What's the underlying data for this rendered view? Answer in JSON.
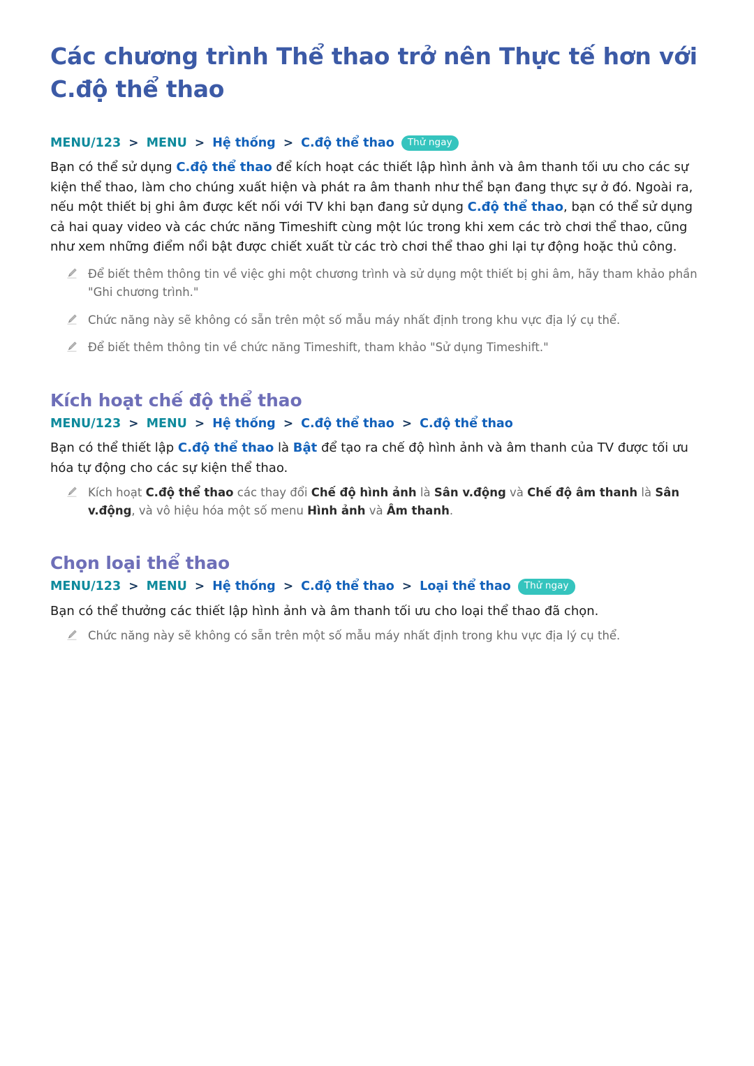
{
  "colors": {
    "title": "#3c5aa6",
    "section_heading": "#6e6fb8",
    "breadcrumb_menu": "#0e8a9c",
    "breadcrumb_item": "#1261ba",
    "breadcrumb_separator": "#16365c",
    "badge_background": "#35c4be",
    "badge_text": "#ffffff",
    "body_text": "#1c1c1c",
    "note_text": "#6b6b6b",
    "inline_emphasis": "#1261ba"
  },
  "document": {
    "title": "Các chương trình Thể thao trở nên Thực tế hơn với C.độ thể thao"
  },
  "intro": {
    "breadcrumb": {
      "menu123": "MENU/123",
      "menu": "MENU",
      "system": "Hệ thống",
      "sports_mode": "C.độ thể thao",
      "separator": ">",
      "badge": "Thử ngay"
    },
    "paragraph": {
      "part1": "Bạn có thể sử dụng ",
      "em1": "C.độ thể thao",
      "part2": " để kích hoạt các thiết lập hình ảnh và âm thanh tối ưu cho các sự kiện thể thao, làm cho chúng xuất hiện và phát ra âm thanh như thể bạn đang thực sự ở đó. Ngoài ra, nếu một thiết bị ghi âm được kết nối với TV khi bạn đang sử dụng ",
      "em2": "C.độ thể thao",
      "part3": ", bạn có thể sử dụng cả hai quay video và các chức năng Timeshift cùng một lúc trong khi xem các trò chơi thể thao, cũng như xem những điểm nổi bật được chiết xuất từ các trò chơi thể thao ghi lại tự động hoặc thủ công."
    },
    "notes": [
      "Để biết thêm thông tin về việc ghi một chương trình và sử dụng một thiết bị ghi âm, hãy tham khảo phần \"Ghi chương trình.\"",
      "Chức năng này sẽ không có sẵn trên một số mẫu máy nhất định trong khu vực địa lý cụ thể.",
      "Để biết thêm thông tin về chức năng Timeshift, tham khảo \"Sử dụng Timeshift.\""
    ]
  },
  "section_activate": {
    "heading": "Kích hoạt chế độ thể thao",
    "breadcrumb": {
      "menu123": "MENU/123",
      "menu": "MENU",
      "system": "Hệ thống",
      "sports_mode": "C.độ thể thao",
      "sports_mode_2": "C.độ thể thao",
      "separator": ">"
    },
    "paragraph": {
      "part1": "Bạn có thể thiết lập ",
      "em1": "C.độ thể thao",
      "part2": " là ",
      "em2": "Bật",
      "part3": " để tạo ra chế độ hình ảnh và âm thanh của TV được tối ưu hóa tự động cho các sự kiện thể thao."
    },
    "note": {
      "part1": "Kích hoạt ",
      "b1": "C.độ thể thao",
      "part2": " các thay đổi ",
      "b2": "Chế độ hình ảnh",
      "part3": " là ",
      "b3": "Sân v.động",
      "part4": " và ",
      "b4": "Chế độ âm thanh",
      "part5": " là ",
      "b5": "Sân v.động",
      "part6": ", và vô hiệu hóa một số menu ",
      "b6": "Hình ảnh",
      "part7": " và ",
      "b7": "Âm thanh",
      "part8": "."
    }
  },
  "section_choose": {
    "heading": "Chọn loại thể thao",
    "breadcrumb": {
      "menu123": "MENU/123",
      "menu": "MENU",
      "system": "Hệ thống",
      "sports_mode": "C.độ thể thao",
      "sport_type": "Loại thể thao",
      "separator": ">",
      "badge": "Thử ngay"
    },
    "paragraph": "Bạn có thể thưởng các thiết lập hình ảnh và âm thanh tối ưu cho loại thể thao đã chọn.",
    "note": "Chức năng này sẽ không có sẵn trên một số mẫu máy nhất định trong khu vực địa lý cụ thể."
  }
}
